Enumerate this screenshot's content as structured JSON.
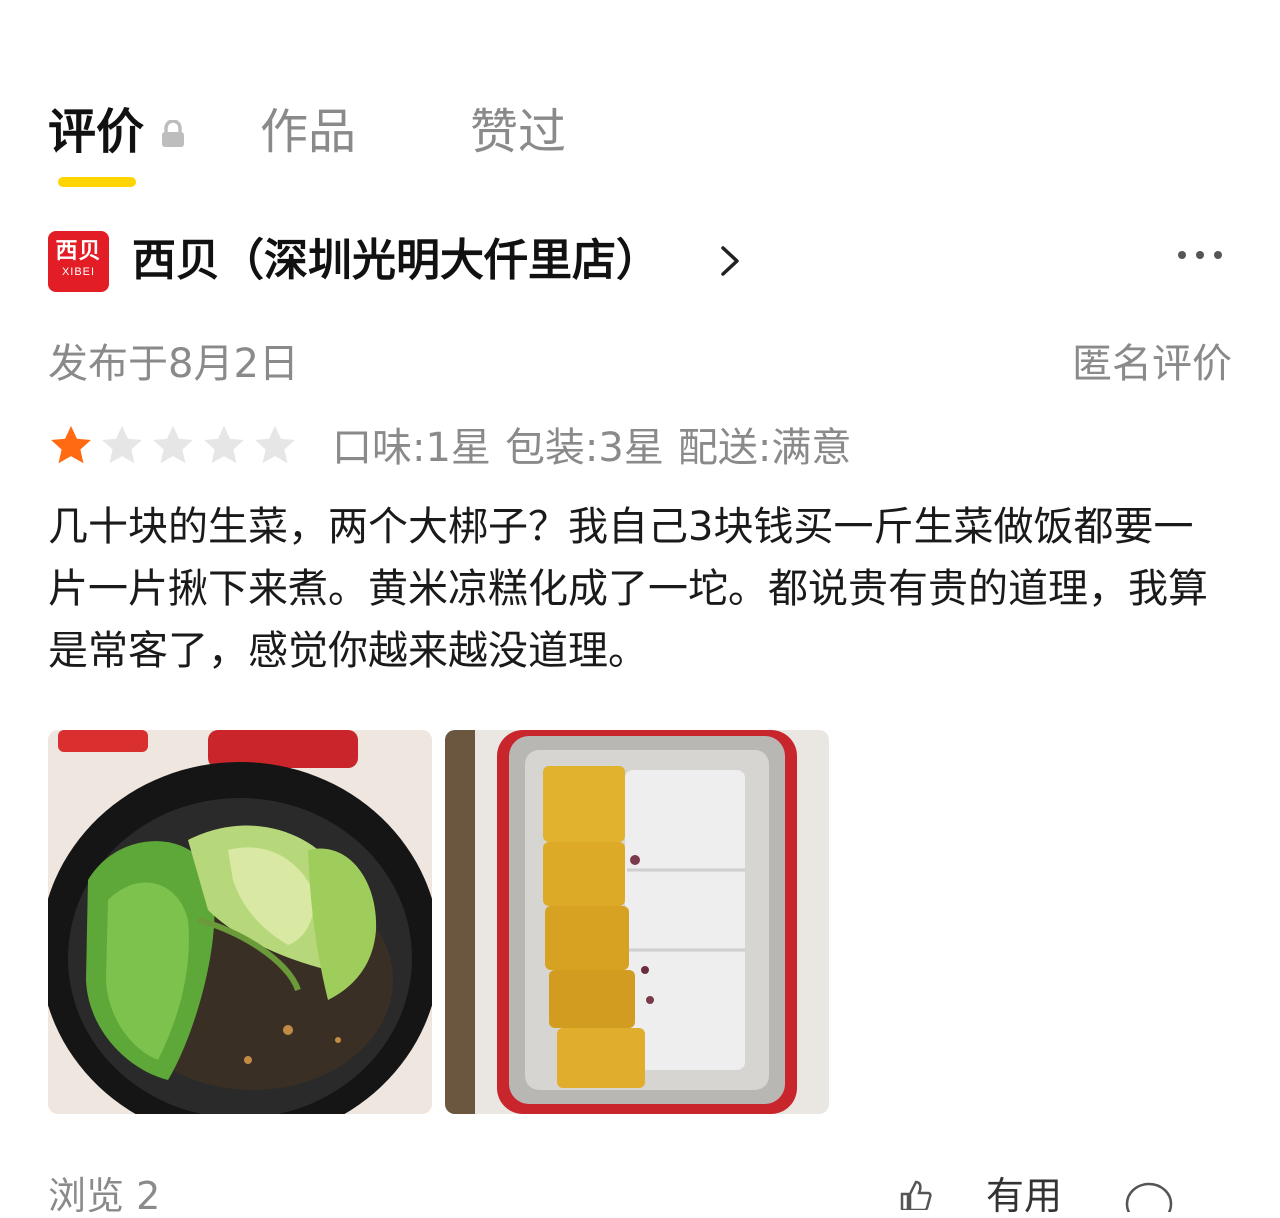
{
  "tabs": [
    {
      "label": "评价",
      "active": true,
      "locked": true
    },
    {
      "label": "作品",
      "active": false
    },
    {
      "label": "赞过",
      "active": false
    }
  ],
  "store": {
    "logo_text": "西贝",
    "logo_subtext": "XIBEI",
    "name": "西贝（深圳光明大仟里店）",
    "chevron_icon": "chevron-right-icon",
    "more_icon": "more-dots-icon"
  },
  "review": {
    "published": "发布于8月2日",
    "anonymous_label": "匿名评价",
    "rating": 1,
    "rating_max": 5,
    "star_active_color": "#ff6a13",
    "star_inactive_color": "#e6e6e6",
    "sub_ratings": [
      "口味:1星",
      "包装:3星",
      "配送:满意"
    ],
    "text": "几十块的生菜，两个大梆子？我自己3块钱买一斤生菜做饭都要一片一片揪下来煮。黄米凉糕化成了一坨。都说贵有贵的道理，我算是常客了，感觉你越来越没道理。",
    "photos": [
      {
        "subject": "lettuce-soup-bowl"
      },
      {
        "subject": "millet-cake-tray"
      }
    ]
  },
  "footer": {
    "views": "浏览 2",
    "useful": "有用"
  },
  "colors": {
    "accent_underline": "#ffd400",
    "brand_red": "#e21d25",
    "muted_text": "#8a8a8a"
  }
}
